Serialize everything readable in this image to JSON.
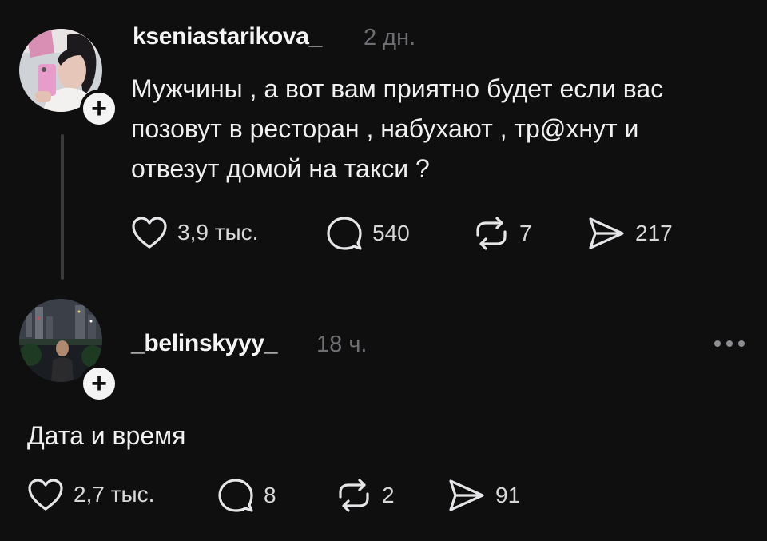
{
  "posts": [
    {
      "username": "kseniaѕtarikova_",
      "time": "2 дн.",
      "text": "Мужчины , а вот вам приятно будет если вас\nпозовут в ресторан , набухают , тр@хнут и\nотвезут домой на такси ?",
      "likes": "3,9 тыс.",
      "comments": "540",
      "reposts": "7",
      "shares": "217"
    },
    {
      "username": "_belinskyyy_",
      "time": "18 ч.",
      "text": "Дата и время",
      "likes": "2,7 тыс.",
      "comments": "8",
      "reposts": "2",
      "shares": "91"
    }
  ],
  "icons": {
    "like": "heart-icon",
    "comment": "comment-bubble-icon",
    "repost": "repost-icon",
    "share": "send-icon",
    "more": "more-dots-icon",
    "follow": "plus-icon"
  },
  "colors": {
    "background": "#0f0f10",
    "text": "#f0f0f0",
    "muted": "#6f6f73",
    "badge": "#f4f4f4"
  },
  "badge_symbol": "+"
}
